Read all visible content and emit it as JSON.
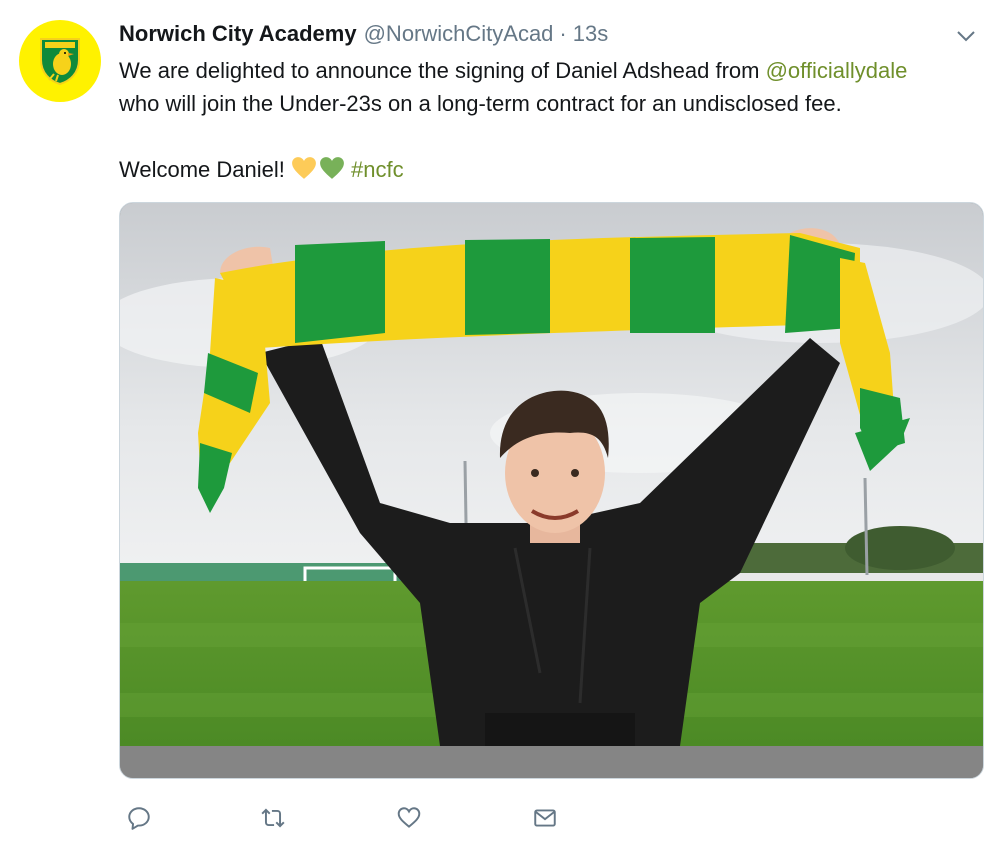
{
  "tweet": {
    "author_name": "Norwich City Academy",
    "author_handle": "@NorwichCityAcad",
    "separator": "·",
    "timestamp": "13s",
    "text_line1_prefix": "We are delighted to announce the signing of Daniel Adshead from ",
    "mention": "@officiallydale",
    "text_line2": "who will join the Under-23s on a long-term contract for an undisclosed fee.",
    "welcome_text": "Welcome Daniel!",
    "hashtag": "#ncfc"
  },
  "icons": {
    "avatar": "norwich-canary-crest-icon",
    "menu": "chevron-down-icon",
    "reply": "reply-icon",
    "retweet": "retweet-icon",
    "like": "heart-icon",
    "share": "envelope-icon",
    "emoji1": "yellow-heart-icon",
    "emoji2": "green-heart-icon"
  },
  "colors": {
    "link": "#6f8f2b",
    "avatar_bg": "#fff200",
    "scarf_yellow": "#f6d21a",
    "scarf_green": "#1e9a3c",
    "muted": "#657786"
  }
}
